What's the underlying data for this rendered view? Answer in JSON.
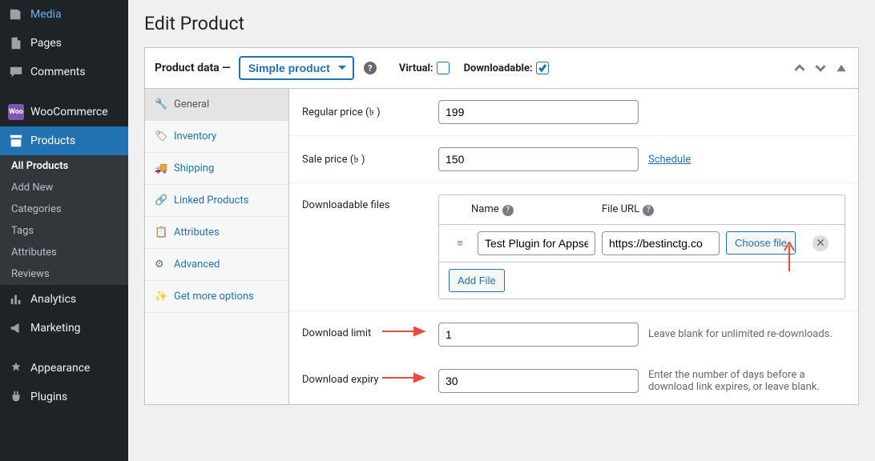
{
  "sidebar": {
    "items": [
      {
        "label": "Media",
        "icon": "media"
      },
      {
        "label": "Pages",
        "icon": "page"
      },
      {
        "label": "Comments",
        "icon": "comment"
      },
      {
        "label": "WooCommerce",
        "icon": "woo"
      },
      {
        "label": "Products",
        "icon": "products",
        "active": true
      },
      {
        "label": "Analytics",
        "icon": "analytics"
      },
      {
        "label": "Marketing",
        "icon": "marketing"
      },
      {
        "label": "Appearance",
        "icon": "appearance"
      },
      {
        "label": "Plugins",
        "icon": "plugins"
      }
    ],
    "submenu": [
      {
        "label": "All Products",
        "active": true
      },
      {
        "label": "Add New"
      },
      {
        "label": "Categories"
      },
      {
        "label": "Tags"
      },
      {
        "label": "Attributes"
      },
      {
        "label": "Reviews"
      }
    ]
  },
  "page": {
    "title": "Edit Product"
  },
  "panel": {
    "title": "Product data —",
    "product_type": "Simple product",
    "virtual_label": "Virtual:",
    "virtual_checked": false,
    "downloadable_label": "Downloadable:",
    "downloadable_checked": true
  },
  "tabs": [
    {
      "label": "General",
      "icon": "wrench",
      "active": true
    },
    {
      "label": "Inventory",
      "icon": "tag"
    },
    {
      "label": "Shipping",
      "icon": "truck"
    },
    {
      "label": "Linked Products",
      "icon": "link"
    },
    {
      "label": "Attributes",
      "icon": "list"
    },
    {
      "label": "Advanced",
      "icon": "gear"
    },
    {
      "label": "Get more options",
      "icon": "spark"
    }
  ],
  "form": {
    "regular_price_label": "Regular price (৳ )",
    "regular_price_value": "199",
    "sale_price_label": "Sale price (৳ )",
    "sale_price_value": "150",
    "schedule_label": "Schedule",
    "download_files_label": "Downloadable files",
    "files_name_header": "Name",
    "files_url_header": "File URL",
    "files": [
      {
        "name": "Test Plugin for Appse",
        "url": "https://bestinctg.co"
      }
    ],
    "choose_file_label": "Choose file",
    "add_file_label": "Add File",
    "download_limit_label": "Download limit",
    "download_limit_value": "1",
    "download_limit_hint": "Leave blank for unlimited re-downloads.",
    "download_expiry_label": "Download expiry",
    "download_expiry_value": "30",
    "download_expiry_hint": "Enter the number of days before a download link expires, or leave blank."
  }
}
